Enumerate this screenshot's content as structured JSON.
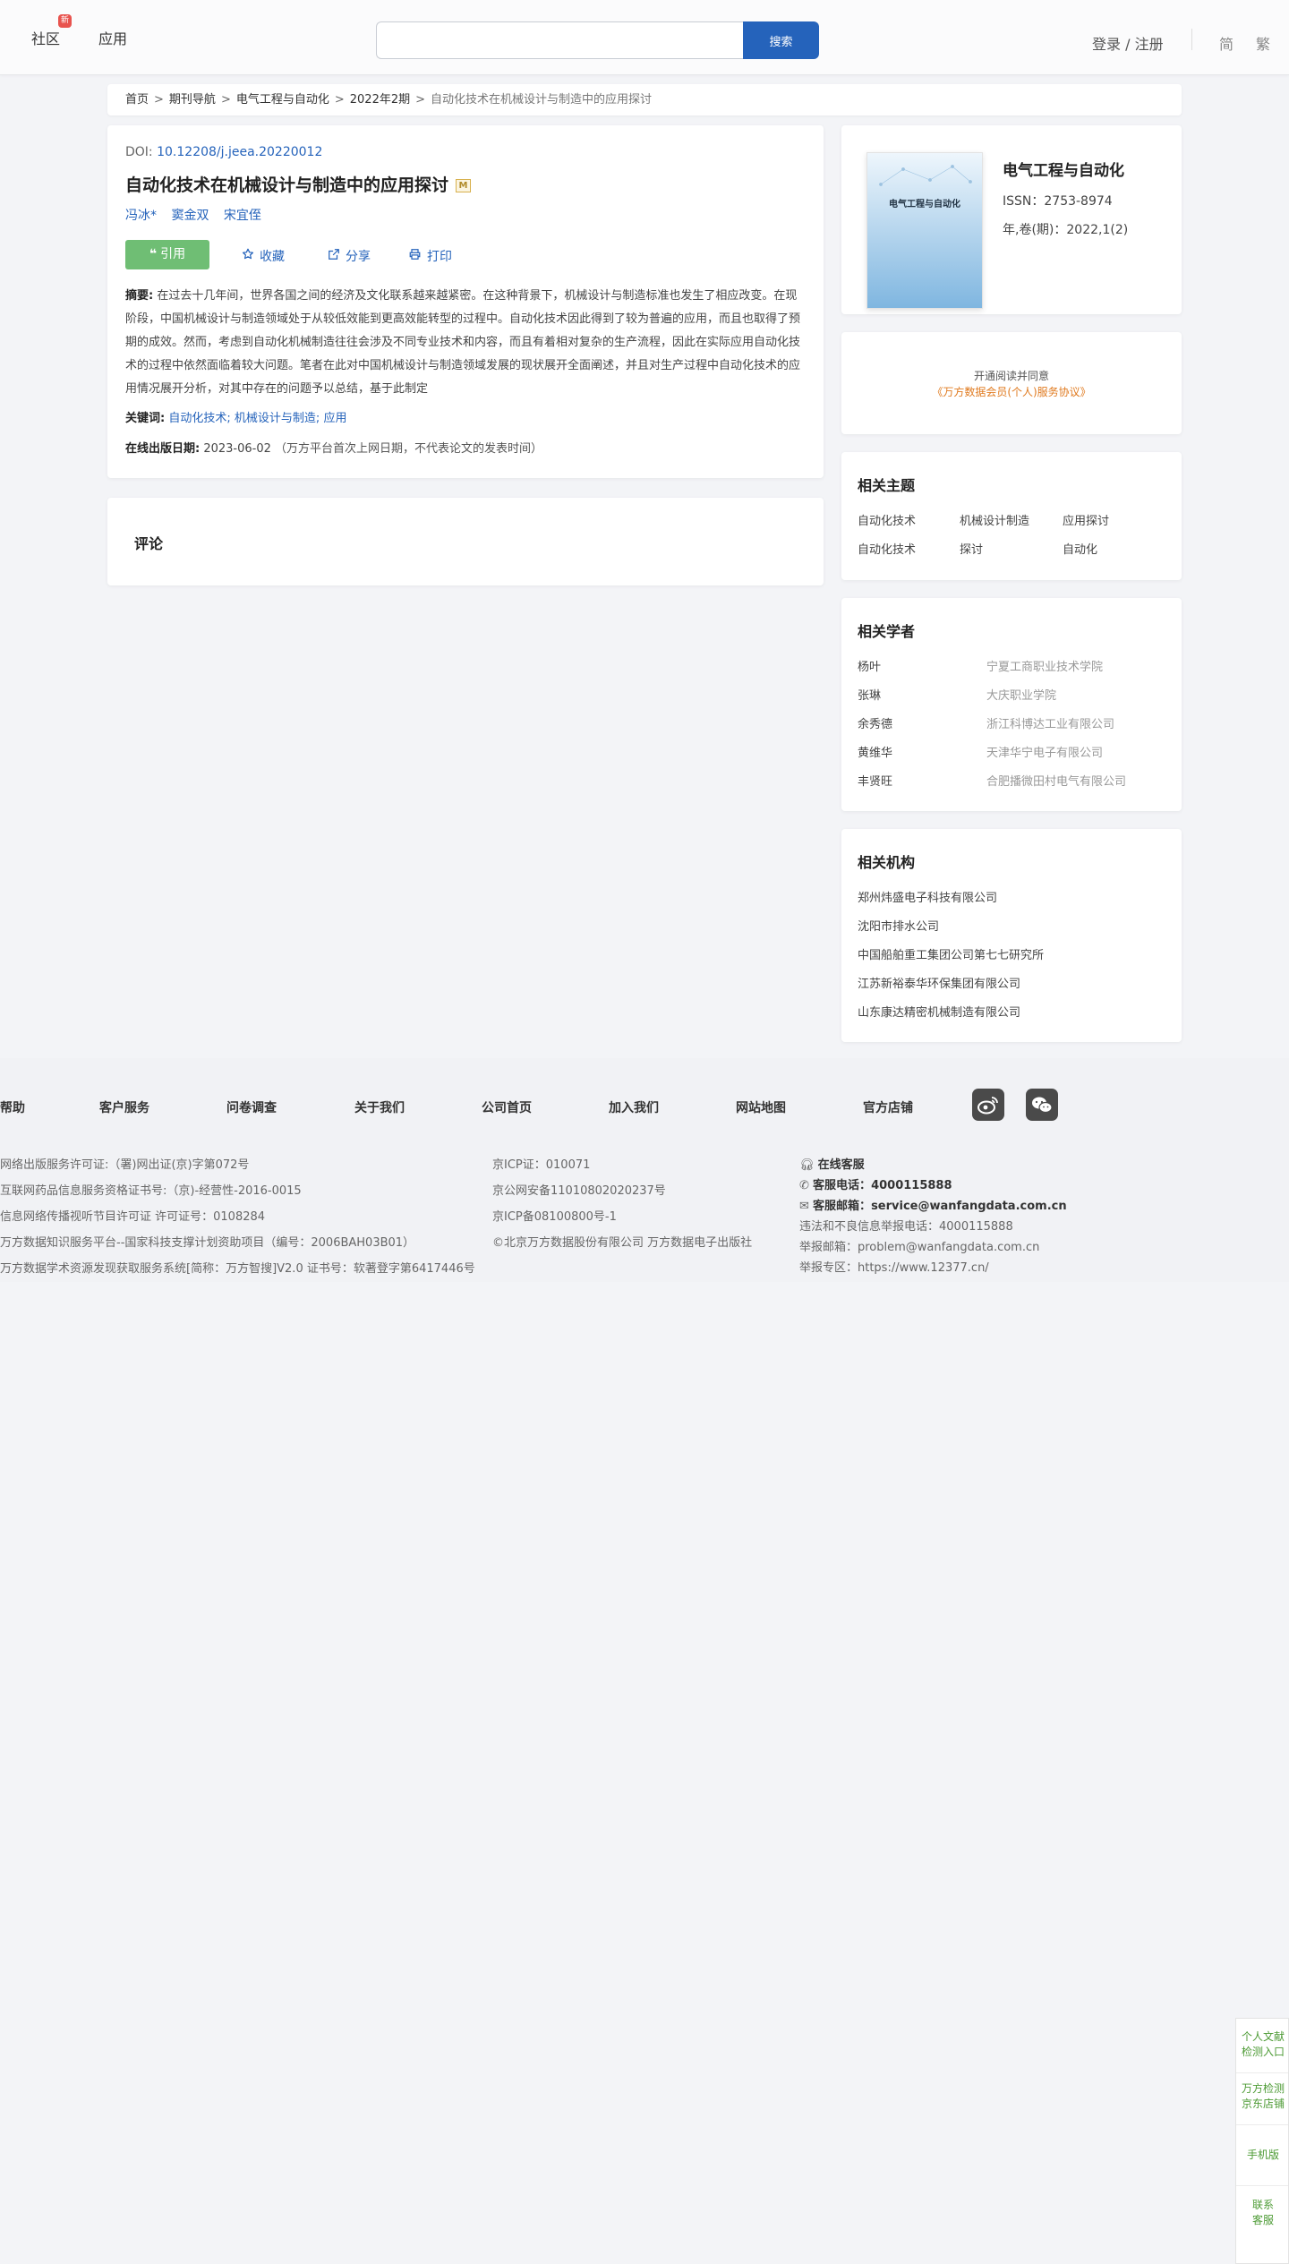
{
  "header": {
    "community": "社区",
    "community_badge": "新",
    "apps": "应用",
    "search_placeholder": "",
    "search_button": "搜索",
    "login": "登录 / 注册",
    "lang_simple": "简",
    "lang_trad": "繁"
  },
  "breadcrumb": [
    "首页",
    "期刊导航",
    "电气工程与自动化",
    "2022年2期",
    "自动化技术在机械设计与制造中的应用探讨"
  ],
  "breadcrumb_sep": ">",
  "article": {
    "doi_label": "DOI: ",
    "doi": "10.12208/j.jeea.20220012",
    "title": "自动化技术在机械设计与制造中的应用探讨",
    "title_badge": "M",
    "authors": [
      "冯冰*",
      "窦金双",
      "宋宜侄"
    ],
    "cite_button": "引用",
    "actions": [
      {
        "icon": "star-icon",
        "label": "收藏"
      },
      {
        "icon": "share-icon",
        "label": "分享"
      },
      {
        "icon": "print-icon",
        "label": "打印"
      }
    ],
    "abstract_label": "摘要:",
    "abstract": "在过去十几年间，世界各国之间的经济及文化联系越来越紧密。在这种背景下，机械设计与制造标准也发生了相应改变。在现阶段，中国机械设计与制造领域处于从较低效能到更高效能转型的过程中。自动化技术因此得到了较为普遍的应用，而且也取得了预期的成效。然而，考虑到自动化机械制造往往会涉及不同专业技术和内容，而且有着相对复杂的生产流程，因此在实际应用自动化技术的过程中依然面临着较大问题。笔者在此对中国机械设计与制造领域发展的现状展开全面阐述，并且对生产过程中自动化技术的应用情况展开分析，对其中存在的问题予以总结，基于此制定",
    "keywords_label": "关键词:",
    "keywords": [
      "自动化技术",
      "机械设计与制造",
      "应用"
    ],
    "keyword_sep": ";",
    "pubdate_label": "在线出版日期:",
    "pubdate": "2023-06-02",
    "pubdate_note": "（万方平台首次上网日期，不代表论文的发表时间）"
  },
  "comments": {
    "title": "评论"
  },
  "journal": {
    "cover_text": "电气工程与自动化",
    "name": "电气工程与自动化",
    "issn": "ISSN：2753-8974",
    "volume": "年,卷(期)：2022,1(2)"
  },
  "agreement": {
    "line1": "开通阅读并同意",
    "line2": "《万方数据会员(个人)服务协议》"
  },
  "related_topics": {
    "title": "相关主题",
    "items": [
      "自动化技术",
      "机械设计制造",
      "应用探讨",
      "自动化技术",
      "探讨",
      "自动化"
    ]
  },
  "related_scholars": {
    "title": "相关学者",
    "items": [
      {
        "name": "杨叶",
        "org": "宁夏工商职业技术学院"
      },
      {
        "name": "张琳",
        "org": "大庆职业学院"
      },
      {
        "name": "余秀德",
        "org": "浙江科博达工业有限公司"
      },
      {
        "name": "黄维华",
        "org": "天津华宁电子有限公司"
      },
      {
        "name": "丰贤旺",
        "org": "合肥播微田村电气有限公司"
      }
    ]
  },
  "related_orgs": {
    "title": "相关机构",
    "items": [
      "郑州炜盛电子科技有限公司",
      "沈阳市排水公司",
      "中国船舶重工集团公司第七七研究所",
      "江苏新裕泰华环保集团有限公司",
      "山东康达精密机械制造有限公司"
    ]
  },
  "footer": {
    "links": [
      "帮助",
      "客户服务",
      "问卷调查",
      "关于我们",
      "公司首页",
      "加入我们",
      "网站地图",
      "官方店铺"
    ],
    "social_icons": [
      "weibo-icon",
      "wechat-icon"
    ],
    "col1": [
      "网络出版服务许可证:（署)网出证(京)字第072号",
      "互联网药品信息服务资格证书号:（京)-经营性-2016-0015",
      "信息网络传播视听节目许可证 许可证号：0108284",
      "万方数据知识服务平台--国家科技支撑计划资助项目（编号：2006BAH03B01）",
      "万方数据学术资源发现获取服务系统[简称：万方智搜]V2.0 证书号：软著登字第6417446号"
    ],
    "col2": [
      "京ICP证：010071",
      "京公网安备11010802020237号",
      "京ICP备08100800号-1",
      "©北京万方数据股份有限公司 万方数据电子出版社"
    ],
    "online_service": "在线客服",
    "phone_label": "客服电话：",
    "phone": "4000115888",
    "email_label": "客服邮箱：",
    "email": "service@wanfangdata.com.cn",
    "report_phone": "违法和不良信息举报电话：4000115888",
    "report_email": "举报邮箱：problem@wanfangdata.com.cn",
    "report_site": "举报专区：https://www.12377.cn/"
  },
  "float_panel": {
    "items": [
      "个人文献检测入口",
      "万方检测京东店铺",
      "手机版",
      "联系客服"
    ]
  },
  "colors": {
    "brand_blue": "#2563bb",
    "cite_green": "#6fbe74",
    "agreement_orange": "#e07a1f"
  }
}
